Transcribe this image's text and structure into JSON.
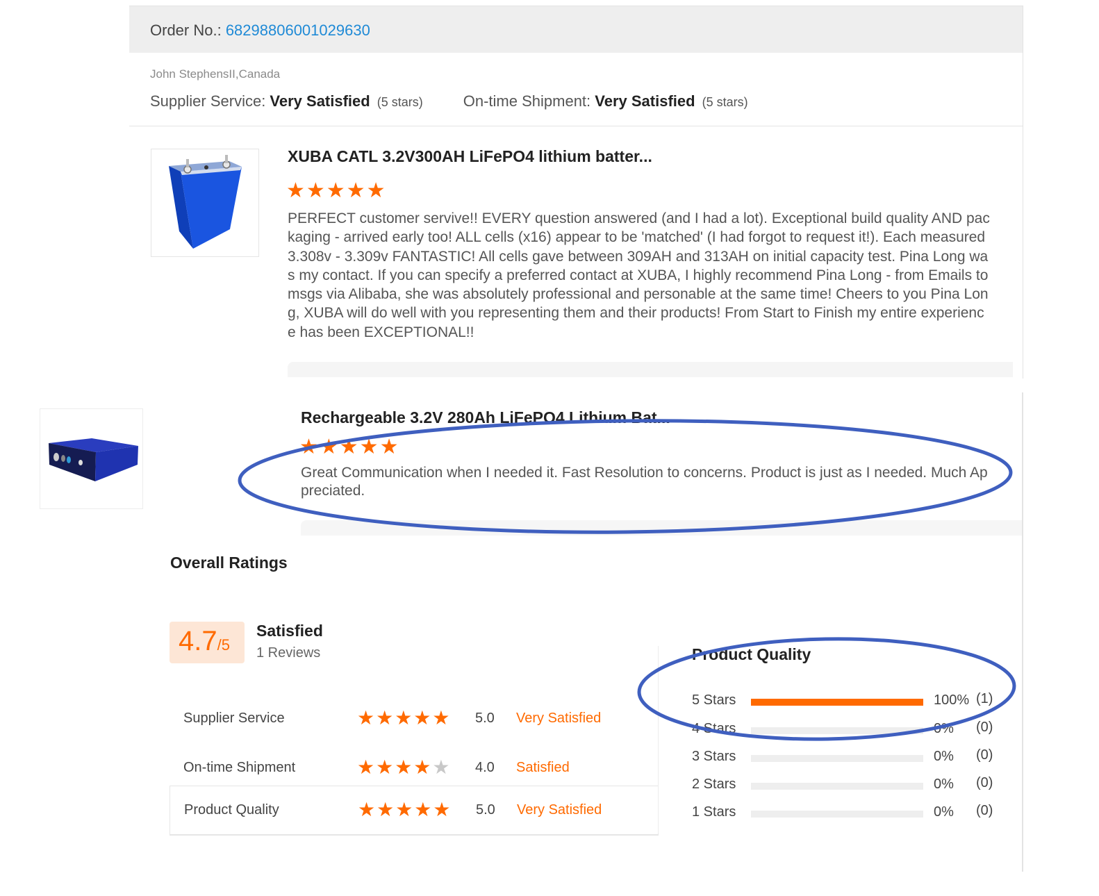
{
  "order": {
    "label": "Order No.: ",
    "number": "68298806001029630"
  },
  "review1": {
    "reviewer": "John StephensII,Canada",
    "supplier_service_label": "Supplier Service: ",
    "supplier_service_value": "Very Satisfied",
    "supplier_service_stars": "(5 stars)",
    "shipment_label": "On-time Shipment: ",
    "shipment_value": "Very Satisfied",
    "shipment_stars": "(5 stars)",
    "product_title": "XUBA CATL 3.2V300AH LiFePO4 lithium batter...",
    "stars": "★★★★★",
    "text": "PERFECT customer servive!! EVERY question answered (and I had a lot). Exceptional build quality AND packaging - arrived early too! ALL cells (x16) appear to be 'matched' (I had forgot to request it!). Each measured 3.308v - 3.309v FANTASTIC! All cells gave between 309AH and 313AH on initial capacity test. Pina Long was my contact. If you can specify a preferred contact at XUBA, I highly recommend Pina Long - from Emails to msgs via Alibaba, she was absolutely professional and personable at the same time! Cheers to you Pina Long, XUBA will do well with you representing them and their products! From Start to Finish my entire experience has been EXCEPTIONAL!!"
  },
  "review2": {
    "product_title": "Rechargeable 3.2V 280Ah LiFePO4 Lithium Bat...",
    "stars": "★★★★★",
    "text": "Great Communication when I needed it. Fast Resolution to concerns. Product is just as I needed. Much Appreciated."
  },
  "overall": {
    "title": "Overall Ratings",
    "score": "4.7",
    "score_max": "/5",
    "summary": "Satisfied",
    "reviews": "1 Reviews",
    "categories": [
      {
        "label": "Supplier Service",
        "stars_on": "★★★★★",
        "stars_off": "",
        "score": "5.0",
        "word": "Very Satisfied"
      },
      {
        "label": "On-time Shipment",
        "stars_on": "★★★★",
        "stars_off": "★",
        "score": "4.0",
        "word": "Satisfied"
      },
      {
        "label": "Product Quality",
        "stars_on": "★★★★★",
        "stars_off": "",
        "score": "5.0",
        "word": "Very Satisfied"
      }
    ],
    "product_quality": {
      "title": "Product Quality",
      "rows": [
        {
          "label": "5  Stars",
          "fraction": 1.0,
          "percent": "100%",
          "count": "(1)"
        },
        {
          "label": "4  Stars",
          "fraction": 0,
          "percent": "0%",
          "count": "(0)"
        },
        {
          "label": "3  Stars",
          "fraction": 0,
          "percent": "0%",
          "count": "(0)"
        },
        {
          "label": "2  Stars",
          "fraction": 0,
          "percent": "0%",
          "count": "(0)"
        },
        {
          "label": "1  Stars",
          "fraction": 0,
          "percent": "0%",
          "count": "(0)"
        }
      ]
    }
  },
  "colors": {
    "accent": "#ff6a00",
    "link": "#1f8ad6",
    "annotation": "#3f5fbf",
    "product_blue": "#1a4fd6"
  },
  "icons": [
    "star-icon",
    "battery-product-image",
    "battery-product-image-2"
  ]
}
